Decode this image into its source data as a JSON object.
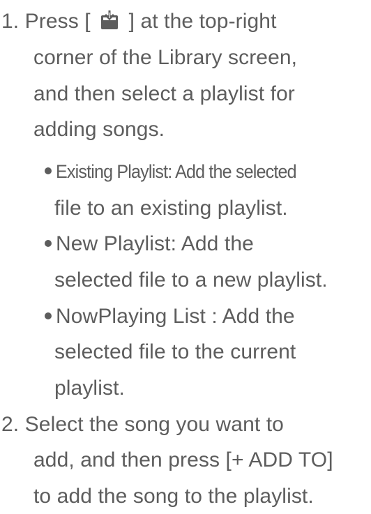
{
  "step1": {
    "number": "1.",
    "line1_before": "Press [",
    "icon": "save-to-playlist-icon",
    "line1_after": "] at the top-right",
    "line2": "corner of the Library screen,",
    "line3": "and then select a playlist for",
    "line4": "adding songs."
  },
  "bullets": [
    {
      "line1": "Existing Playlist: Add the selected",
      "line2": "file to an existing playlist."
    },
    {
      "line1": "New Playlist: Add the",
      "line2": "selected file to a new playlist."
    },
    {
      "line1": "NowPlaying List : Add the",
      "line2": "selected file to the current",
      "line3": "playlist."
    }
  ],
  "step2": {
    "number": "2.",
    "line1": "Select the song you want to",
    "line2": "add, and then press [+ ADD TO]",
    "line3": "to add the song to the playlist."
  },
  "colors": {
    "text": "#5d5d5d",
    "background": "#ffffff"
  }
}
